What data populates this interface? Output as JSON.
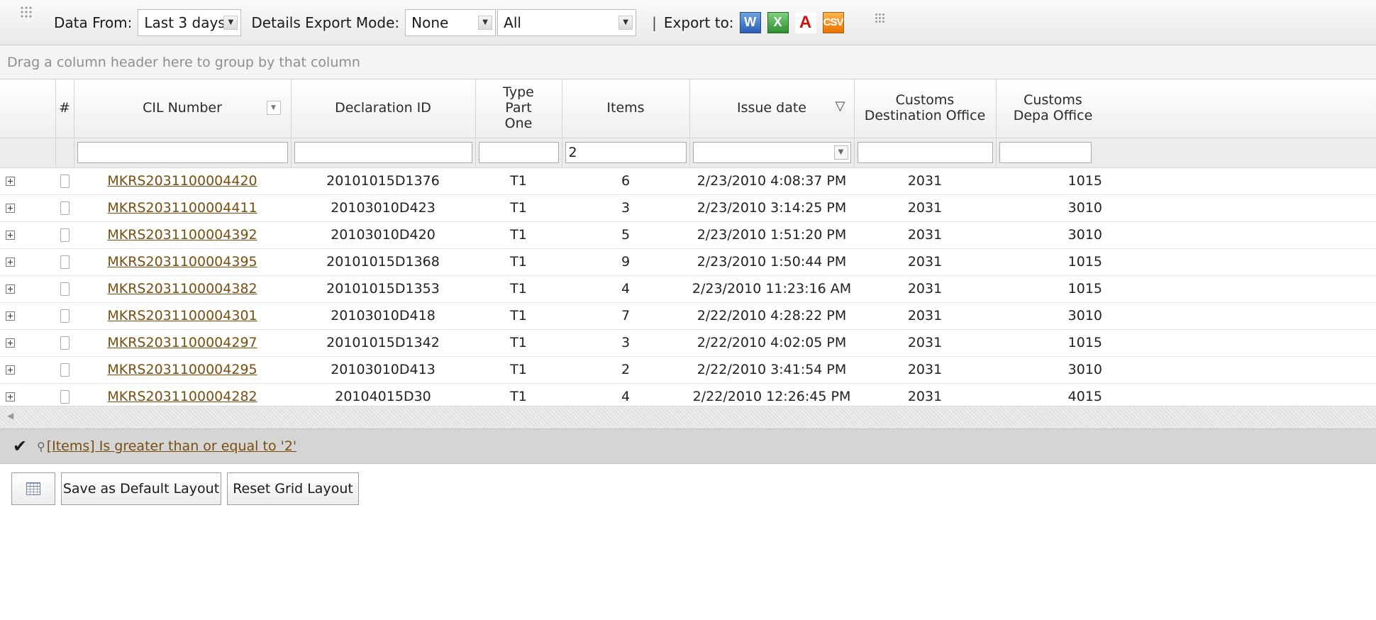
{
  "toolbar": {
    "data_from_label": "Data From:",
    "data_from_value": "Last 3 days",
    "export_mode_label": "Details Export Mode:",
    "export_mode_value": "None",
    "filter_value": "All",
    "separator": "|",
    "export_to_label": "Export to:",
    "export_icons": [
      {
        "name": "word-export-icon",
        "glyph": "W",
        "color": "#2b5fb4"
      },
      {
        "name": "excel-export-icon",
        "glyph": "X",
        "color": "#2f8f2f"
      },
      {
        "name": "pdf-export-icon",
        "glyph": "A",
        "color": "#d30f0f"
      },
      {
        "name": "csv-export-icon",
        "glyph": "CSV",
        "color": "#e77200"
      }
    ]
  },
  "group_panel": {
    "text": "Drag a column header here to group by that column"
  },
  "grid": {
    "columns": [
      {
        "key": "expand",
        "label": ""
      },
      {
        "key": "num",
        "label": "#"
      },
      {
        "key": "cil",
        "label": "CIL Number"
      },
      {
        "key": "decl",
        "label": "Declaration ID"
      },
      {
        "key": "type",
        "label": "Type Part One"
      },
      {
        "key": "items",
        "label": "Items"
      },
      {
        "key": "date",
        "label": "Issue date"
      },
      {
        "key": "dest",
        "label": "Customs Destination Office"
      },
      {
        "key": "dep",
        "label": "Customs Depa Office"
      }
    ],
    "filters": {
      "items": "2"
    },
    "rows": [
      {
        "cil": "MKRS2031100004420",
        "decl": "20101015D1376",
        "type": "T1",
        "items": "6",
        "date": "2/23/2010 4:08:37 PM",
        "dest": "2031",
        "dep": "1015"
      },
      {
        "cil": "MKRS2031100004411",
        "decl": "20103010D423",
        "type": "T1",
        "items": "3",
        "date": "2/23/2010 3:14:25 PM",
        "dest": "2031",
        "dep": "3010"
      },
      {
        "cil": "MKRS2031100004392",
        "decl": "20103010D420",
        "type": "T1",
        "items": "5",
        "date": "2/23/2010 1:51:20 PM",
        "dest": "2031",
        "dep": "3010"
      },
      {
        "cil": "MKRS2031100004395",
        "decl": "20101015D1368",
        "type": "T1",
        "items": "9",
        "date": "2/23/2010 1:50:44 PM",
        "dest": "2031",
        "dep": "1015"
      },
      {
        "cil": "MKRS2031100004382",
        "decl": "20101015D1353",
        "type": "T1",
        "items": "4",
        "date": "2/23/2010 11:23:16 AM",
        "dest": "2031",
        "dep": "1015"
      },
      {
        "cil": "MKRS2031100004301",
        "decl": "20103010D418",
        "type": "T1",
        "items": "7",
        "date": "2/22/2010 4:28:22 PM",
        "dest": "2031",
        "dep": "3010"
      },
      {
        "cil": "MKRS2031100004297",
        "decl": "20101015D1342",
        "type": "T1",
        "items": "3",
        "date": "2/22/2010 4:02:05 PM",
        "dest": "2031",
        "dep": "1015"
      },
      {
        "cil": "MKRS2031100004295",
        "decl": "20103010D413",
        "type": "T1",
        "items": "2",
        "date": "2/22/2010 3:41:54 PM",
        "dest": "2031",
        "dep": "3010"
      },
      {
        "cil": "MKRS2031100004282",
        "decl": "20104015D30",
        "type": "T1",
        "items": "4",
        "date": "2/22/2010 12:26:45 PM",
        "dest": "2031",
        "dep": "4015"
      }
    ]
  },
  "filter_bar": {
    "text": "[Items] Is greater than or equal to '2'"
  },
  "buttons": {
    "save_default": "Save as Default Layout",
    "reset_grid": "Reset Grid Layout"
  }
}
